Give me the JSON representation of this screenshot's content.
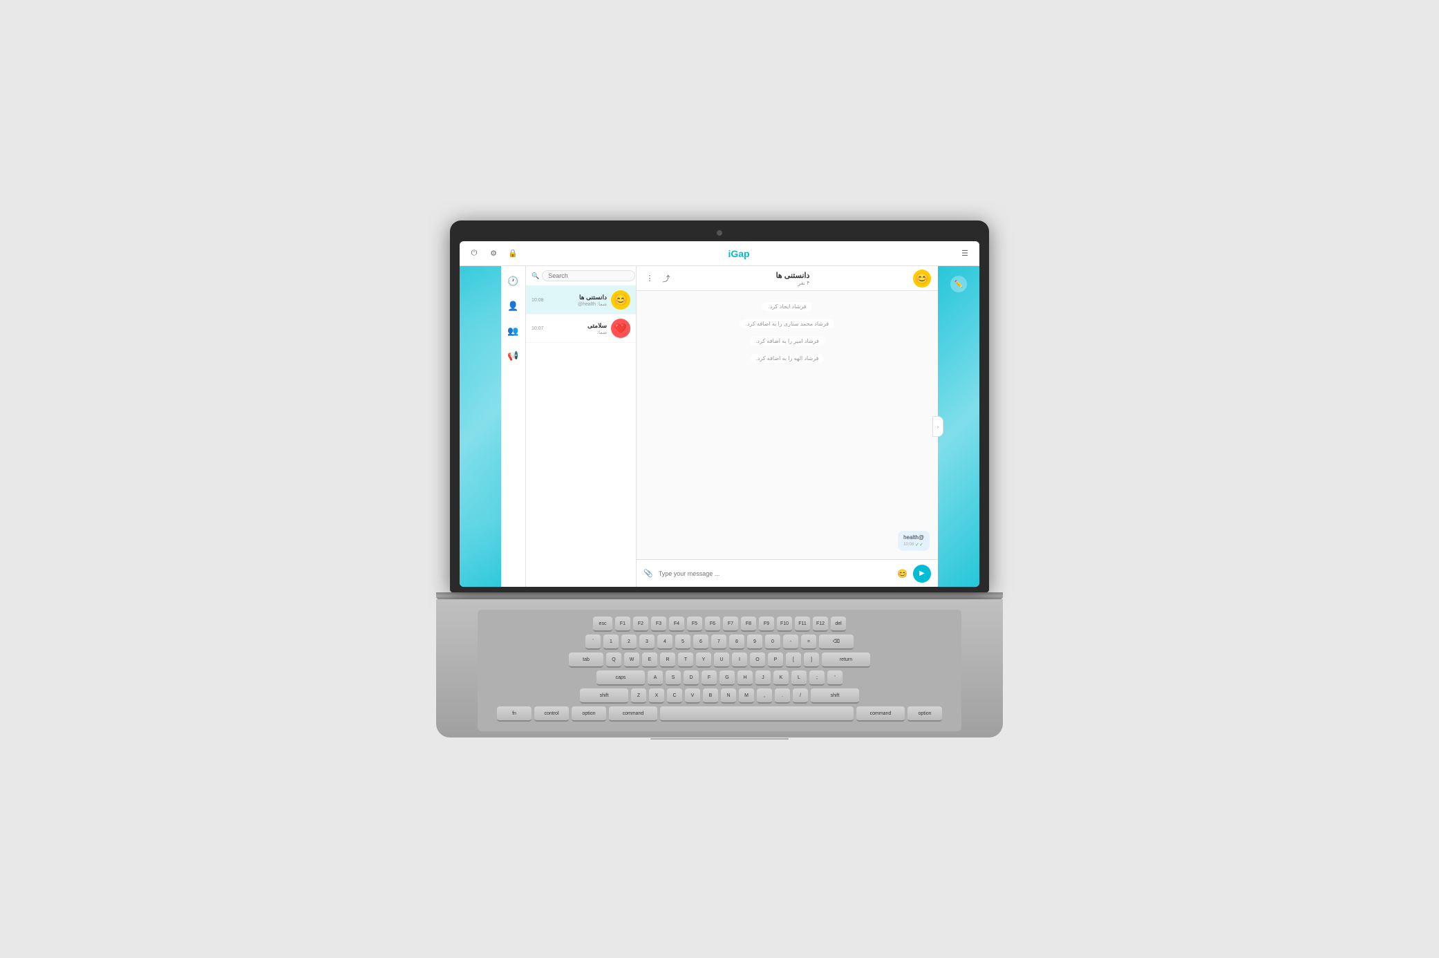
{
  "app": {
    "name": "iGap",
    "title": "دانستنی ها"
  },
  "header": {
    "logo": "iGap",
    "power_icon": "⏻",
    "settings_icon": "⚙",
    "lock_icon": "🔒",
    "menu_icon": "☰"
  },
  "chat_header": {
    "title": "دانستنی ها",
    "member_count": "۴ نفر",
    "more_icon": "⋮",
    "share_icon": "⤴"
  },
  "search": {
    "placeholder": "Search"
  },
  "chat_list": {
    "items": [
      {
        "name": "دانستنی ها",
        "preview": "شما: health@",
        "time": "10:08",
        "avatar_emoji": "😊",
        "active": true
      },
      {
        "name": "سلامتی",
        "preview": "شما:",
        "time": "10:07",
        "avatar_emoji": "❤️",
        "active": false
      }
    ]
  },
  "messages": {
    "system_messages": [
      "فرشاد ایجاد کرد.",
      "فرشاد محمد ستاری را به اضافه کرد.",
      "فرشاد امیر را به اضافه کرد.",
      "فرشاد الهه را به اضافه کرد."
    ],
    "bubbles": [
      {
        "text": "@health",
        "time": "10:08",
        "type": "sent",
        "checked": true
      }
    ]
  },
  "input": {
    "placeholder": "Type your message ..."
  },
  "nav_icons": [
    {
      "icon": "🕐",
      "name": "recent"
    },
    {
      "icon": "👤",
      "name": "contacts"
    },
    {
      "icon": "👥",
      "name": "groups",
      "active": true
    },
    {
      "icon": "📢",
      "name": "channels"
    }
  ]
}
